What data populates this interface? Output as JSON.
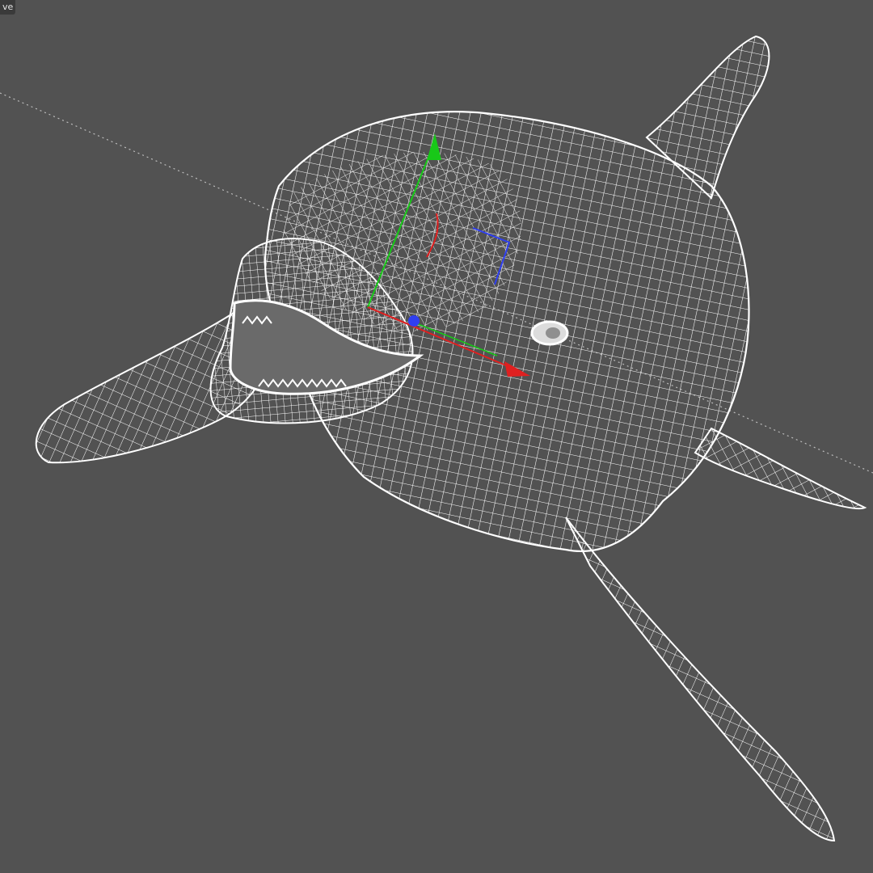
{
  "viewport": {
    "label": "ve",
    "background": "#525252",
    "wire_color": "#ffffff",
    "ground_line_color": "#bdbdbd"
  },
  "model": {
    "name": "dolphin-wireframe",
    "shading": "wireframe"
  },
  "gizmo": {
    "x_axis_color": "#e02020",
    "y_axis_color": "#18c818",
    "z_axis_color": "#2f3ff0"
  }
}
